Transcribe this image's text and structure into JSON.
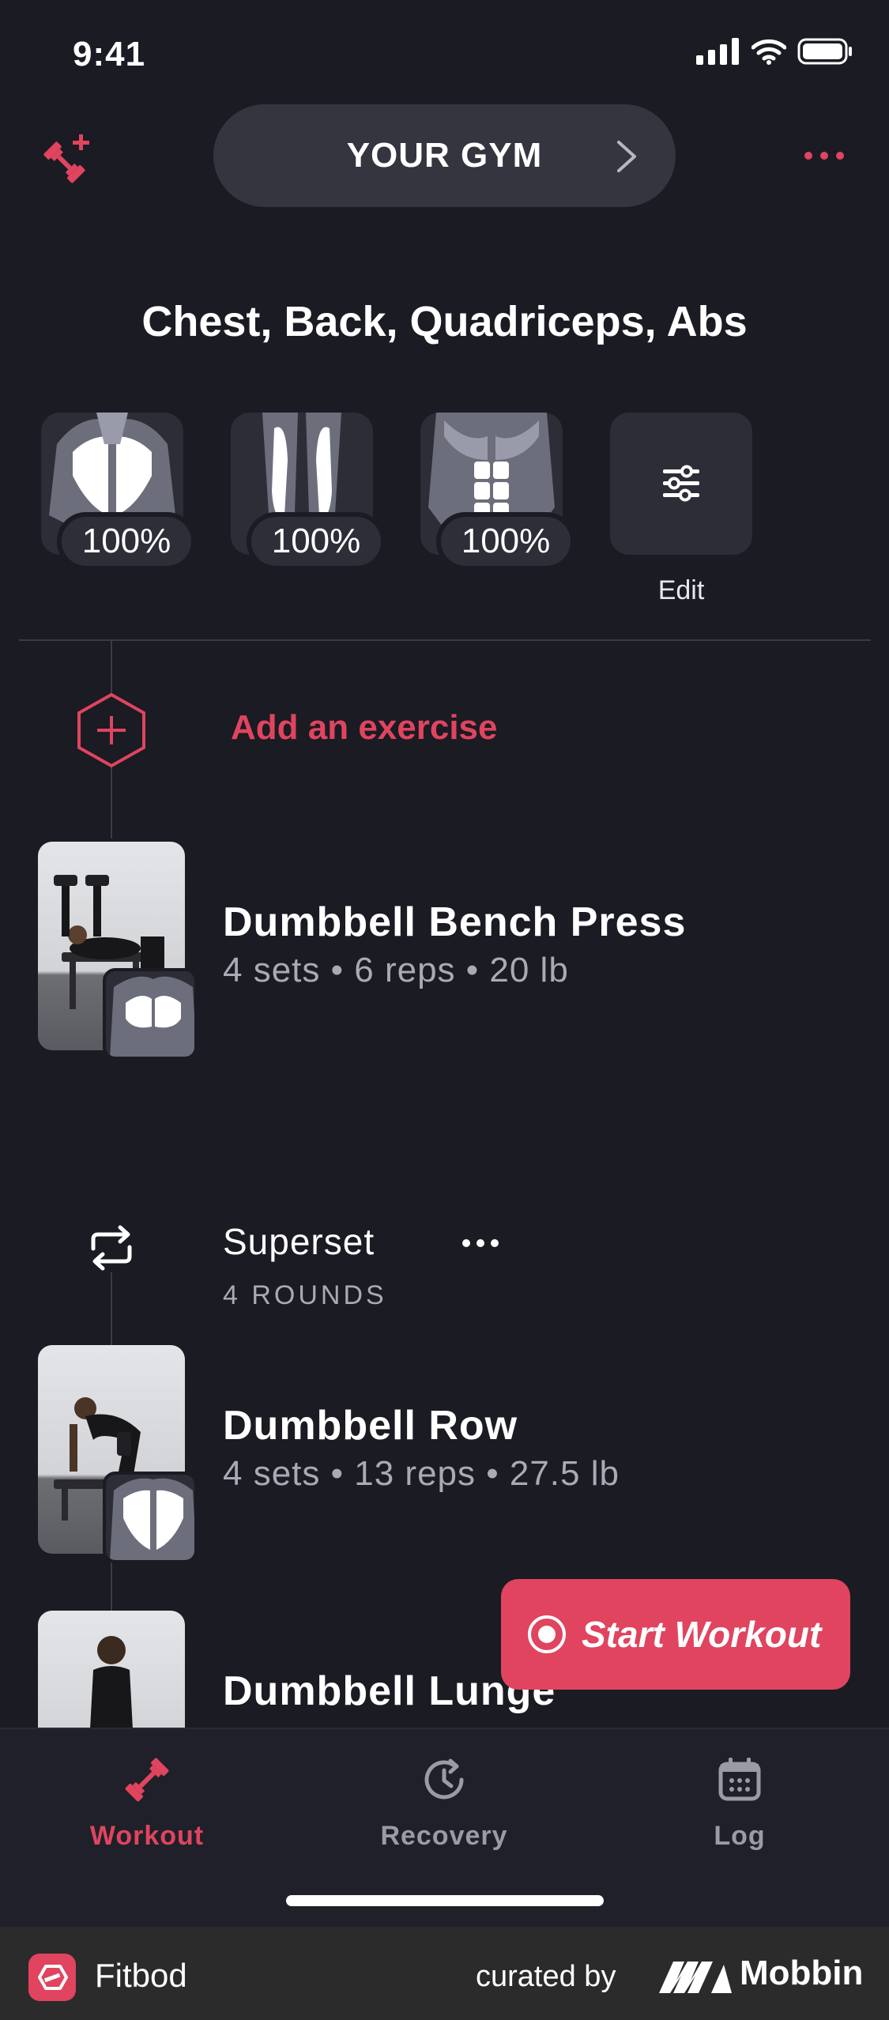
{
  "status_bar": {
    "time": "9:41"
  },
  "header": {
    "gym_label": "YOUR GYM"
  },
  "muscle_groups": {
    "title": "Chest, Back, Quadriceps, Abs",
    "items": [
      {
        "icon": "back-muscle-icon",
        "recovery": "100%"
      },
      {
        "icon": "quadriceps-muscle-icon",
        "recovery": "100%"
      },
      {
        "icon": "abs-muscle-icon",
        "recovery": "100%"
      }
    ],
    "edit_label": "Edit"
  },
  "add_exercise": {
    "label": "Add an exercise"
  },
  "exercises": [
    {
      "name": "Dumbbell Bench Press",
      "meta": "4 sets • 6 reps • 20 lb"
    },
    {
      "name": "Dumbbell Row",
      "meta": "4 sets • 13 reps • 27.5 lb"
    },
    {
      "name": "Dumbbell Lunge",
      "meta": ""
    }
  ],
  "superset": {
    "title": "Superset",
    "rounds": "4 ROUNDS"
  },
  "start_button": {
    "label": "Start Workout"
  },
  "tabs": [
    {
      "label": "Workout",
      "icon": "dumbbell-icon",
      "active": true
    },
    {
      "label": "Recovery",
      "icon": "recovery-clock-icon",
      "active": false
    },
    {
      "label": "Log",
      "icon": "calendar-icon",
      "active": false
    }
  ],
  "footer": {
    "app_name": "Fitbod",
    "curated_by": "curated by",
    "brand": "Mobbin"
  },
  "colors": {
    "accent": "#e0445f",
    "background": "#1a1b23",
    "card": "#2c2d37"
  }
}
